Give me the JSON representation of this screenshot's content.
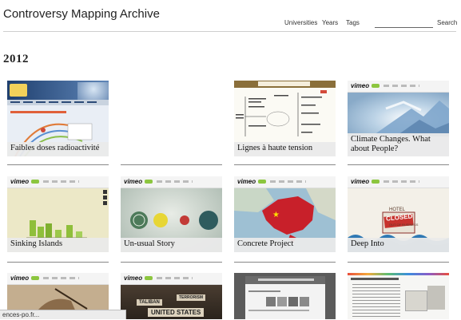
{
  "site_title": "Controversy Mapping Archive",
  "nav": {
    "universities": "Universities",
    "years": "Years",
    "tags": "Tags",
    "search_label": "Search",
    "search_value": ""
  },
  "year_heading": "2012",
  "projects": [
    {
      "title": "Faibles doses radioactivité",
      "thumb": "faibles-doses-website"
    },
    {
      "title": "Lignes à haute tension",
      "thumb": "lignes-diagram"
    },
    {
      "title": "Climate Changes. What about People?",
      "thumb": "vimeo-climate"
    },
    {
      "title": "Sinking Islands",
      "thumb": "vimeo-sinking-islands"
    },
    {
      "title": "Un-usual Story",
      "thumb": "vimeo-unusual-story"
    },
    {
      "title": "Concrete Project",
      "thumb": "vimeo-china-map"
    },
    {
      "title": "Deep Into",
      "thumb": "vimeo-hotel-closed"
    }
  ],
  "row3_thumbs": [
    {
      "label_1": "TALIBAN",
      "label_2": "TERRORISM",
      "label_3": "UNITED STATES"
    }
  ],
  "hotel_sign": {
    "line1": "HOTEL",
    "line2": "CLOSED",
    "line3": "OUT OF BUSINESS"
  },
  "vimeo_logo": "vimeo",
  "status_url": "ences-po.fr...",
  "colors": {
    "caption_bg": "#eaeaea",
    "vimeo_green": "#8cc63f",
    "china_red": "#c8202a"
  }
}
